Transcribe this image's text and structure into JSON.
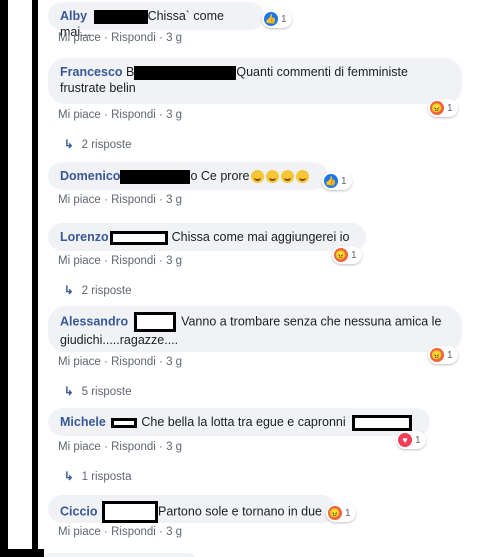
{
  "meta": {
    "like_label": "Mi piace",
    "reply_label": "Rispondi",
    "dot": "·",
    "time": "3 g"
  },
  "comments": [
    {
      "name": "Alby",
      "text": "Chissa` come mai...",
      "reaction": "like",
      "count": "1"
    },
    {
      "name": "Francesco",
      "text_prefix": "B",
      "text": "Quanti commenti di femministe frustrate belin",
      "reaction": "angry",
      "count": "1",
      "replies": "2 risposte"
    },
    {
      "name": "Domenico",
      "text_prefix": "o",
      "text": "Ce prore",
      "reaction": "like",
      "count": "1"
    },
    {
      "name": "Lorenzo",
      "text": "Chissa come mai aggiungerei io",
      "reaction": "angry",
      "count": "1",
      "replies": "2 risposte"
    },
    {
      "name": "Alessandro",
      "text": "Vanno a trombare senza che nessuna amica le giudichi.....ragazze....",
      "reaction": "angry",
      "count": "1",
      "replies": "5 risposte"
    },
    {
      "name": "Michele",
      "text": "Che bella la lotta tra egue e capronni",
      "reaction": "heart",
      "count": "1",
      "replies": "1 risposta"
    },
    {
      "name": "Ciccio",
      "text": "Partono sole e tornano in due",
      "reaction": "angry",
      "count": "1"
    }
  ],
  "icons": {
    "like": "thumbs-up-icon",
    "angry": "angry-face-icon",
    "heart": "heart-icon",
    "reply_arrow": "reply-arrow-icon",
    "laugh": "laughing-emoji-icon"
  },
  "colors": {
    "name": "#385898",
    "bubble": "#f0f2f5",
    "meta": "#606770",
    "like": "#1877f2",
    "angry": "#f0623c",
    "heart": "#f33e58"
  }
}
